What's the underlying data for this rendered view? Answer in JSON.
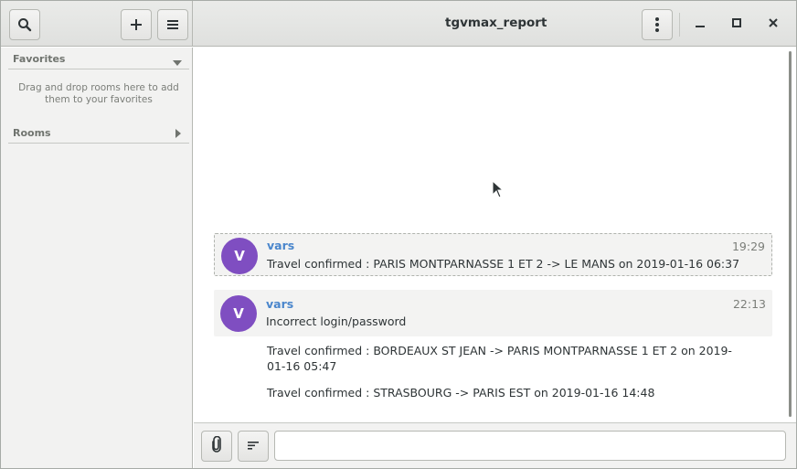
{
  "window": {
    "title": "tgvmax_report"
  },
  "header": {
    "search_icon": "search-icon",
    "add_icon": "plus-icon",
    "menu_icon": "hamburger-icon",
    "room_menu_icon": "vertical-dots-icon",
    "minimize_icon": "minimize-icon",
    "maximize_icon": "maximize-icon",
    "close_icon": "close-icon"
  },
  "sidebar": {
    "favorites_label": "Favorites",
    "favorites_hint": "Drag and drop rooms here to add them to your favorites",
    "rooms_label": "Rooms"
  },
  "messages": [
    {
      "avatar_letter": "V",
      "sender": "vars",
      "time": "19:29",
      "lines": [
        "Travel confirmed : PARIS MONTPARNASSE 1 ET 2 -> LE MANS on 2019-01-16 06:37"
      ]
    },
    {
      "avatar_letter": "V",
      "sender": "vars",
      "time": "22:13",
      "lines": [
        "Incorrect login/password",
        "Travel confirmed : BORDEAUX ST JEAN -> PARIS MONTPARNASSE 1 ET 2 on 2019-01-16 05:47",
        "Travel confirmed : STRASBOURG -> PARIS EST on 2019-01-16 14:48"
      ]
    }
  ],
  "composer": {
    "attach_icon": "paperclip-icon",
    "format_icon": "text-format-icon",
    "input_value": ""
  },
  "colors": {
    "avatar": "#7f4ec1",
    "sender": "#4a86cc",
    "headerbar": "#e4e5e3",
    "sidebar": "#f2f2f1"
  }
}
